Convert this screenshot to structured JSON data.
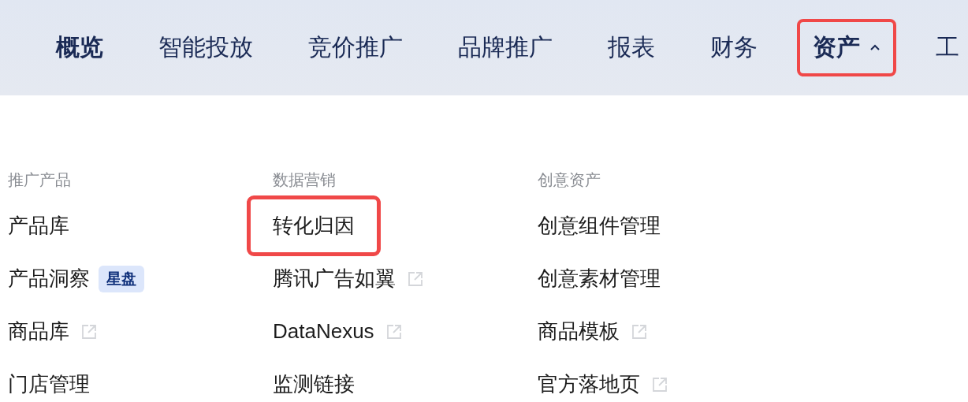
{
  "nav": [
    {
      "label": "概览",
      "kind": "link",
      "selected": true,
      "highlighted": false
    },
    {
      "label": "智能投放",
      "kind": "link",
      "selected": false,
      "highlighted": false
    },
    {
      "label": "竞价推广",
      "kind": "link",
      "selected": false,
      "highlighted": false
    },
    {
      "label": "品牌推广",
      "kind": "link",
      "selected": false,
      "highlighted": false
    },
    {
      "label": "报表",
      "kind": "link",
      "selected": false,
      "highlighted": false
    },
    {
      "label": "财务",
      "kind": "link",
      "selected": false,
      "highlighted": false
    },
    {
      "label": "资产",
      "kind": "menu",
      "selected": true,
      "expanded": true,
      "highlighted": true
    },
    {
      "label": "工",
      "kind": "link",
      "selected": false,
      "highlighted": false
    }
  ],
  "menu": [
    {
      "heading": "推广产品",
      "items": [
        {
          "label": "产品库",
          "external": false,
          "highlighted": false
        },
        {
          "label": "产品洞察",
          "external": false,
          "badge": "星盘",
          "highlighted": false
        },
        {
          "label": "商品库",
          "external": true,
          "highlighted": false
        },
        {
          "label": "门店管理",
          "external": false,
          "highlighted": false
        }
      ]
    },
    {
      "heading": "数据营销",
      "items": [
        {
          "label": "转化归因",
          "external": false,
          "highlighted": true
        },
        {
          "label": "腾讯广告如翼",
          "external": true,
          "highlighted": false
        },
        {
          "label": "DataNexus",
          "external": true,
          "highlighted": false
        },
        {
          "label": "监测链接",
          "external": false,
          "highlighted": false
        }
      ]
    },
    {
      "heading": "创意资产",
      "items": [
        {
          "label": "创意组件管理",
          "external": false,
          "highlighted": false
        },
        {
          "label": "创意素材管理",
          "external": false,
          "highlighted": false
        },
        {
          "label": "商品模板",
          "external": true,
          "highlighted": false
        },
        {
          "label": "官方落地页",
          "external": true,
          "highlighted": false
        }
      ]
    }
  ]
}
